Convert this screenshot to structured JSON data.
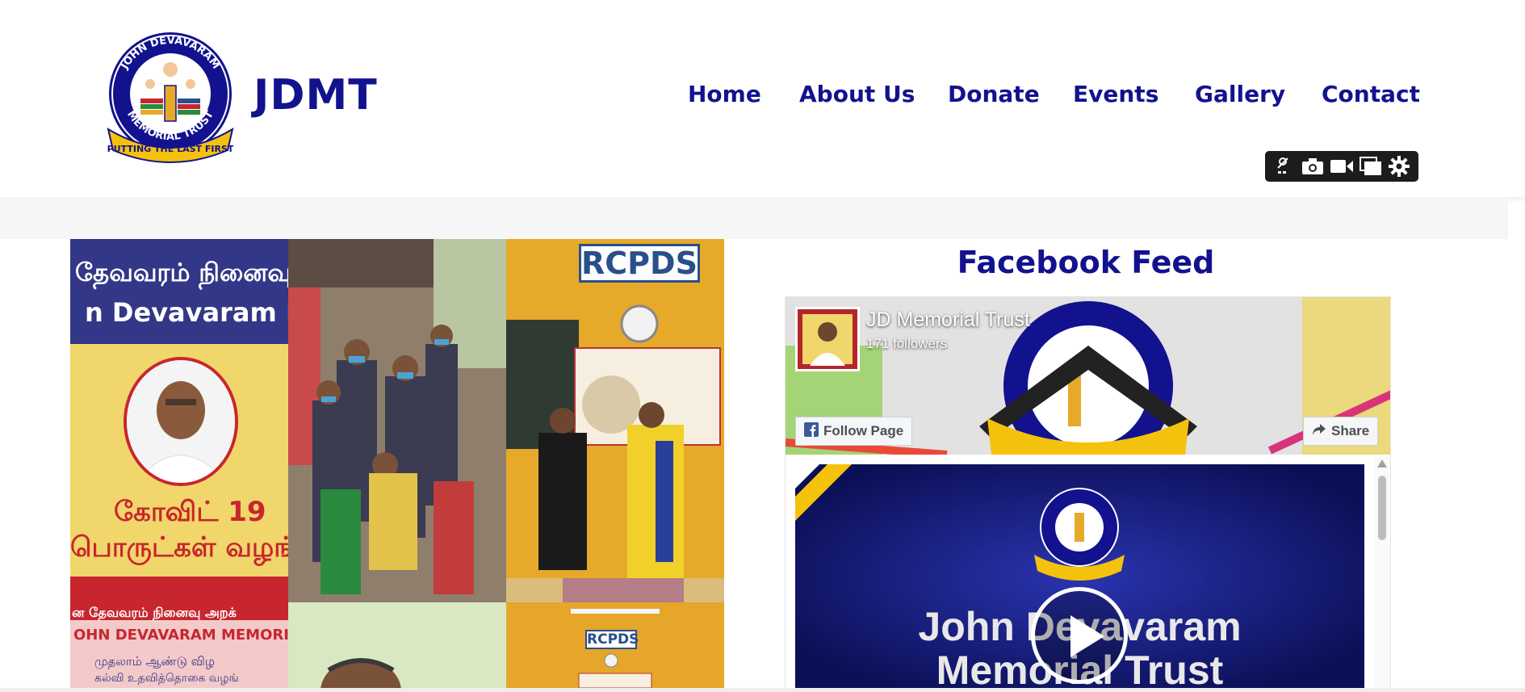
{
  "brand": {
    "logo_text_top": "JOHN DEVAVARAM",
    "logo_text_bottom": "MEMORIAL TRUST",
    "logo_ribbon": "PUTTING THE LAST FIRST",
    "name": "JDMT"
  },
  "nav": {
    "items": [
      {
        "label": "Home"
      },
      {
        "label": "About Us"
      },
      {
        "label": "Donate"
      },
      {
        "label": "Events"
      },
      {
        "label": "Gallery"
      },
      {
        "label": "Contact"
      }
    ]
  },
  "toolbar": {
    "icons": [
      "pin-off-icon",
      "camera-icon",
      "video-icon",
      "windows-icon",
      "gear-icon"
    ]
  },
  "collage": {
    "banner_line1": "தேவவரம் நினைவு",
    "banner_line2": "n Devavaram Me",
    "covid_line1": "கோவிட் 19",
    "covid_line2": "பொருட்கள் வழங்",
    "rcpds_sign": "RCPDS",
    "rcpds_sign_small": "RCPDS",
    "bottom_banner_line1": "ன தேவவரம் நினைவு அறக்",
    "bottom_banner_line2": "OHN DEVAVARAM MEMORIAL",
    "bottom_banner_line3": "முதலாம் ஆண்டு விழ",
    "bottom_banner_line4": "கல்வி உதவித்தொகை வழங்"
  },
  "facebook": {
    "section_title": "Facebook Feed",
    "page_name": "JD Memorial Trust",
    "followers": "171 followers",
    "follow_button": "Follow Page",
    "share_button": "Share",
    "post_title_line1": "John Devavaram",
    "post_title_line2": "Memorial Trust"
  },
  "colors": {
    "brand_navy": "#12128f",
    "banner_red": "#c8262e",
    "banner_yellow": "#f1d66b",
    "fb_post_blue": "#141a7a"
  }
}
